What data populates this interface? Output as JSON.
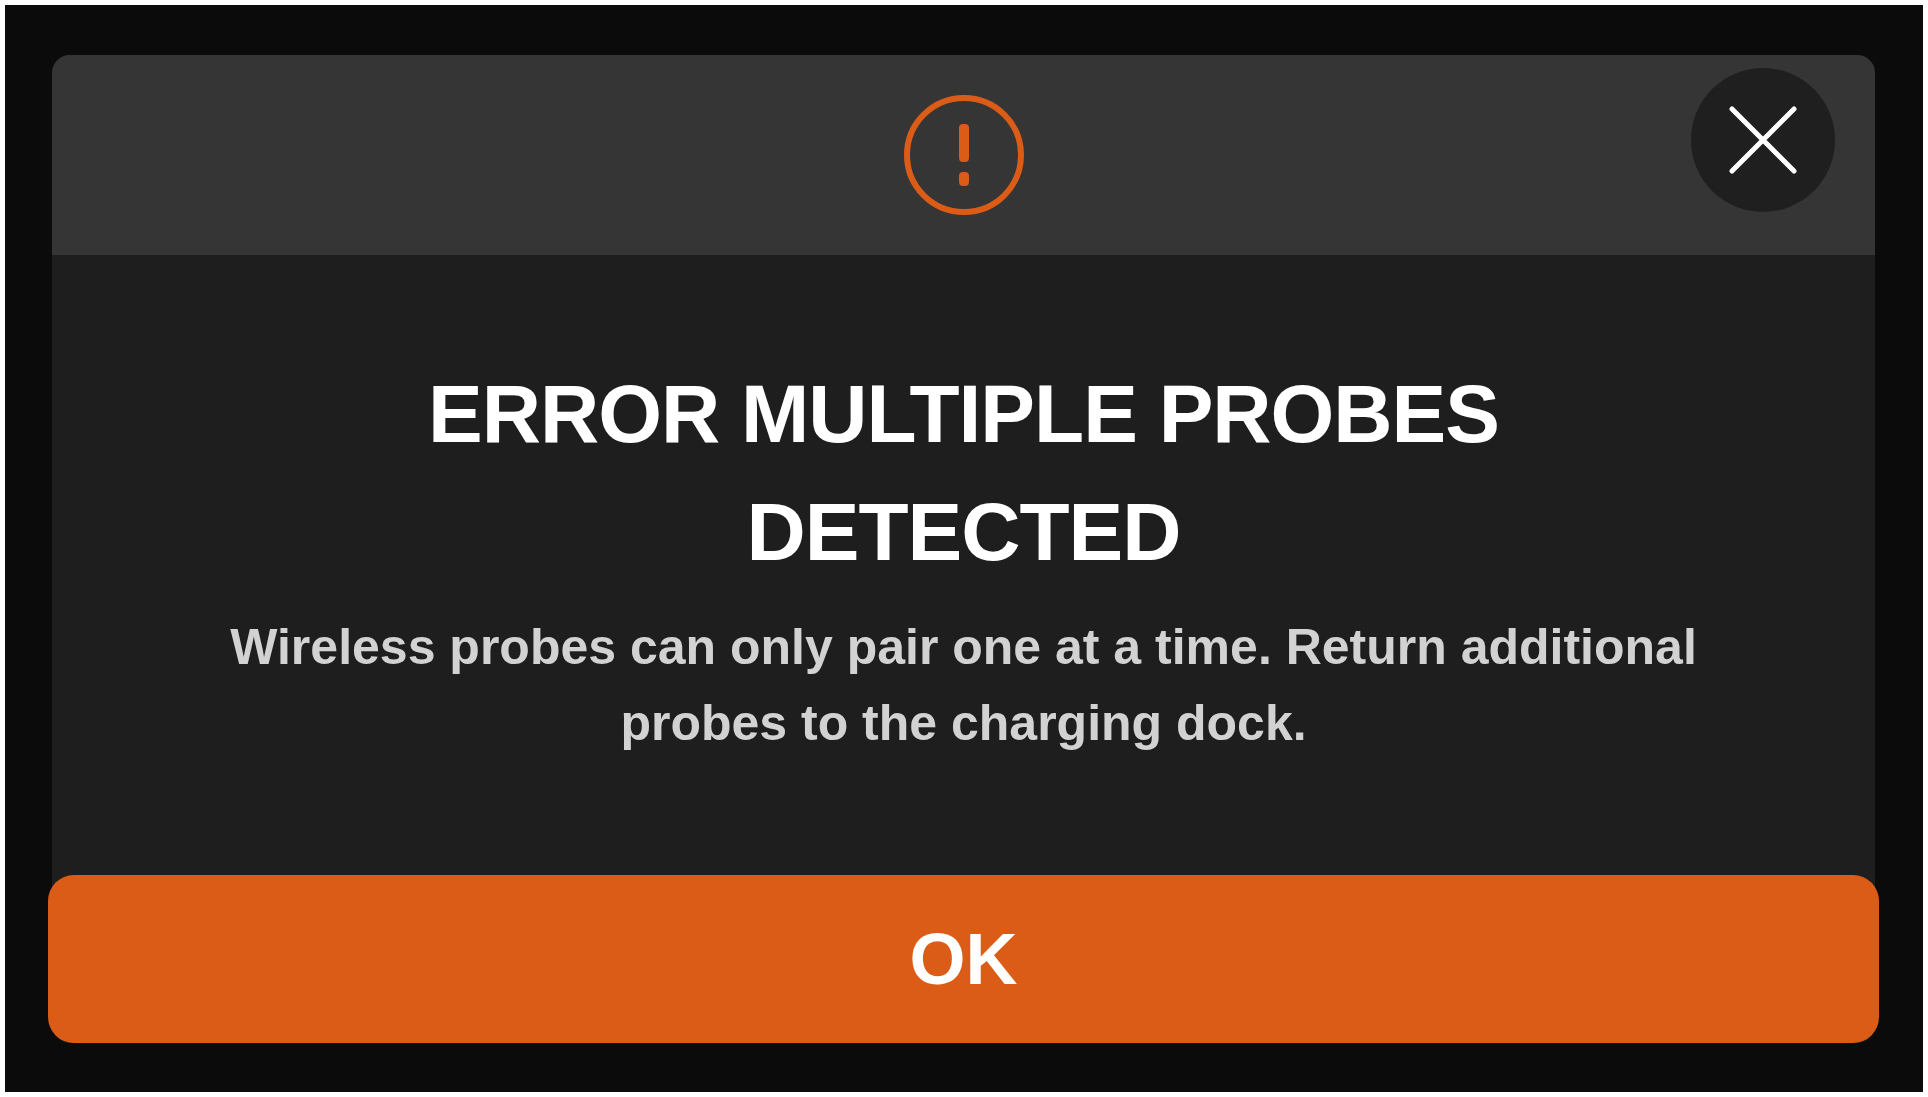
{
  "dialog": {
    "title": "ERROR MULTIPLE PROBES DETECTED",
    "message": "Wireless probes can only pair one at a time. Return additional probes to the charging dock.",
    "button": "OK"
  }
}
